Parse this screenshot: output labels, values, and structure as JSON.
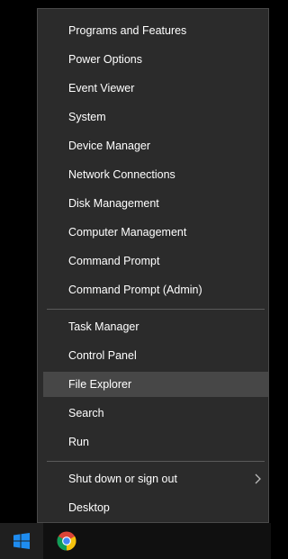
{
  "menu": {
    "group1": [
      {
        "label": "Programs and Features"
      },
      {
        "label": "Power Options"
      },
      {
        "label": "Event Viewer"
      },
      {
        "label": "System"
      },
      {
        "label": "Device Manager"
      },
      {
        "label": "Network Connections"
      },
      {
        "label": "Disk Management"
      },
      {
        "label": "Computer Management"
      },
      {
        "label": "Command Prompt"
      },
      {
        "label": "Command Prompt (Admin)"
      }
    ],
    "group2": [
      {
        "label": "Task Manager"
      },
      {
        "label": "Control Panel"
      },
      {
        "label": "File Explorer",
        "highlighted": true
      },
      {
        "label": "Search"
      },
      {
        "label": "Run"
      }
    ],
    "group3": [
      {
        "label": "Shut down or sign out",
        "has_submenu": true,
        "submenu_icon": "chevron-right-icon"
      },
      {
        "label": "Desktop"
      }
    ]
  },
  "taskbar": {
    "start_icon": "windows-logo-icon",
    "pinned": [
      {
        "icon": "chrome-icon"
      }
    ]
  },
  "colors": {
    "menu_background": "#2b2b2b",
    "highlight": "#474747",
    "text": "#ffffff",
    "windows_blue": "#1e8cf0"
  }
}
